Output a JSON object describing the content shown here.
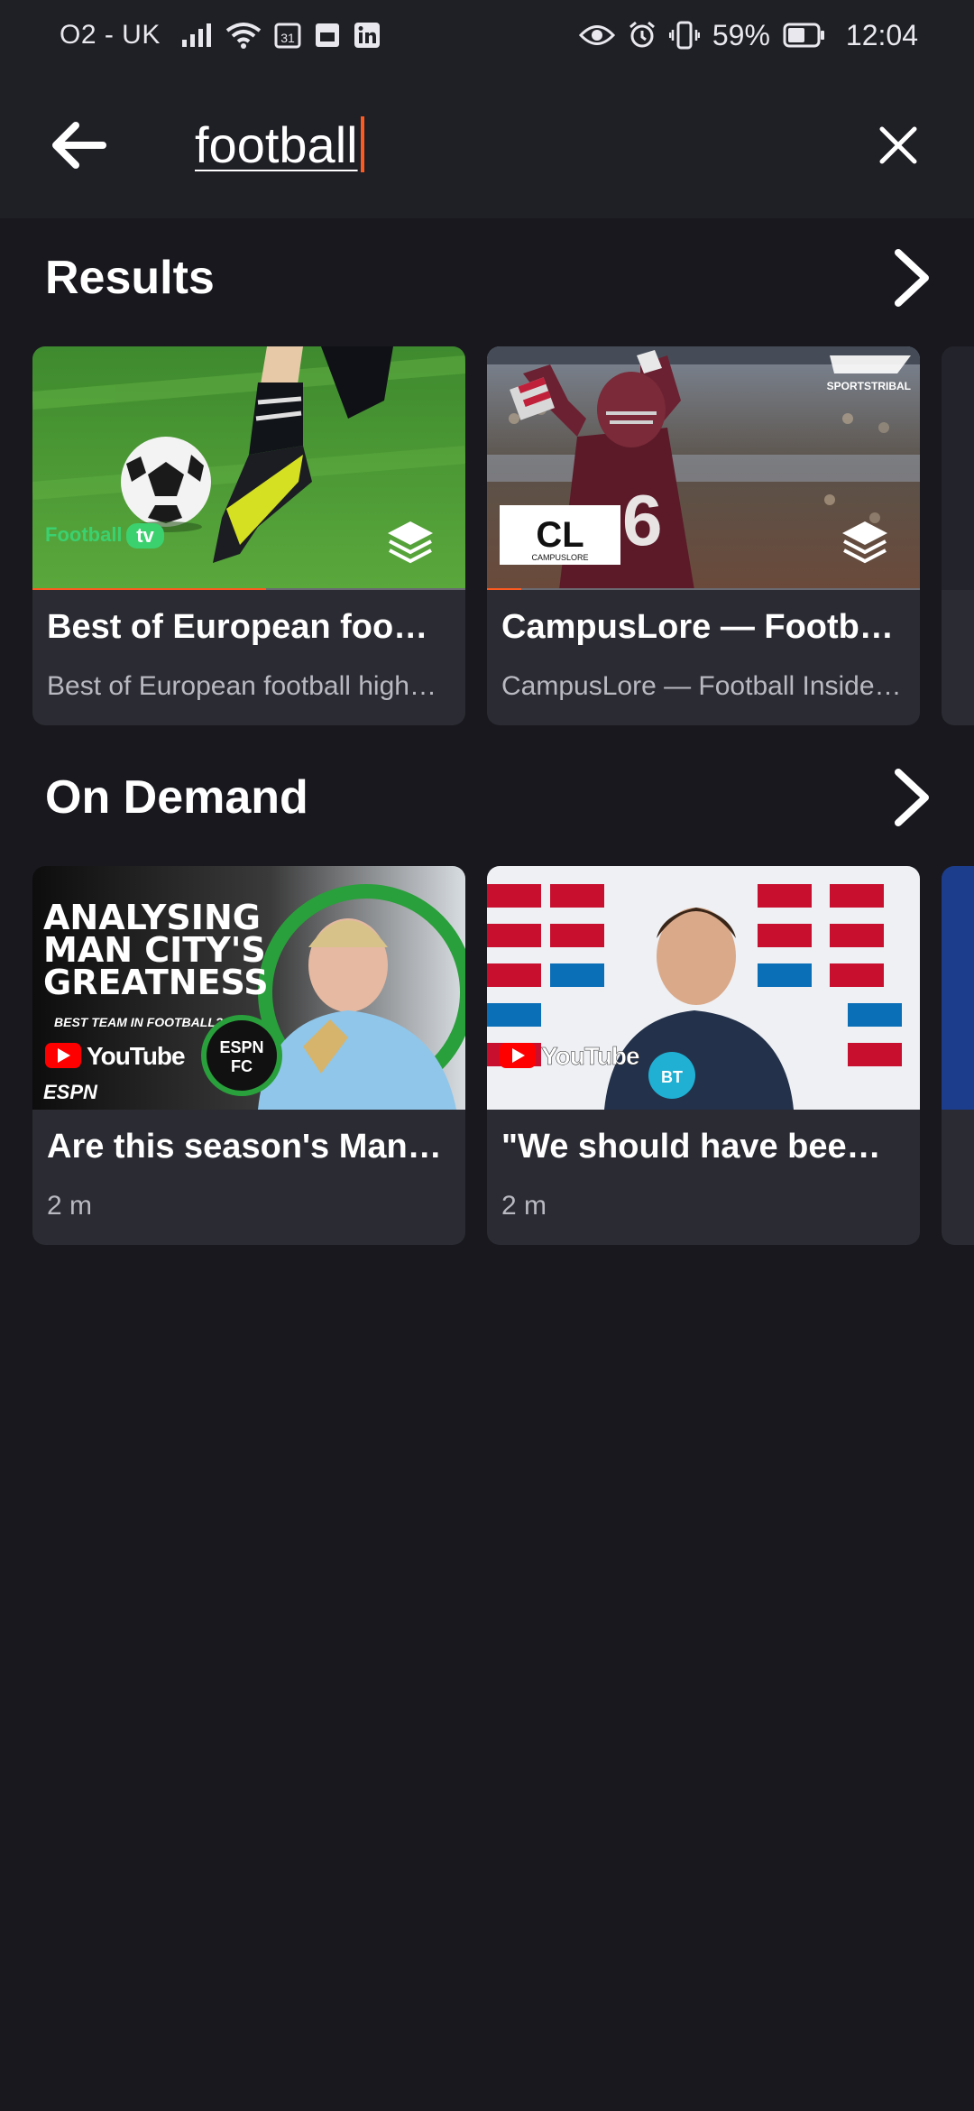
{
  "status_bar": {
    "carrier": "O2 - UK",
    "calendar_day": "31",
    "battery": "59%",
    "time": "12:04"
  },
  "search": {
    "query": "football"
  },
  "sections": {
    "results": {
      "title": "Results",
      "cards": [
        {
          "title": "Best of European foo…",
          "subtitle": "Best of European football high…",
          "thumb_logo": "Football",
          "thumb_logo_tv": "tv",
          "progress": 0.54
        },
        {
          "title": "CampusLore — Footb…",
          "subtitle": "CampusLore — Football Inside…",
          "thumb_logo": "CL",
          "thumb_logo_sub": "CAMPUSLORE",
          "thumb_brand": "SPORTSTRIBAL",
          "progress": 0.08
        }
      ]
    },
    "on_demand": {
      "title": "On Demand",
      "cards": [
        {
          "title": "Are this season's Man…",
          "duration": "2 m",
          "thumb_headline": [
            "ANALYSING",
            "MAN CITY'S",
            "GREATNESS"
          ],
          "thumb_tagline": "BEST TEAM IN FOOTBALL?",
          "thumb_source": "YouTube",
          "thumb_brand": "ESPN"
        },
        {
          "title": "\"We should have bee…",
          "duration": "2 m",
          "thumb_source": "YouTube"
        }
      ]
    }
  },
  "colors": {
    "background": "#18181e",
    "header": "#1f1f26",
    "card": "#2b2b33",
    "accent": "#ff5a1f"
  },
  "icons": {
    "back": "arrow-left-icon",
    "clear": "close-icon",
    "more": "chevron-right-icon",
    "collection": "layers-icon"
  }
}
